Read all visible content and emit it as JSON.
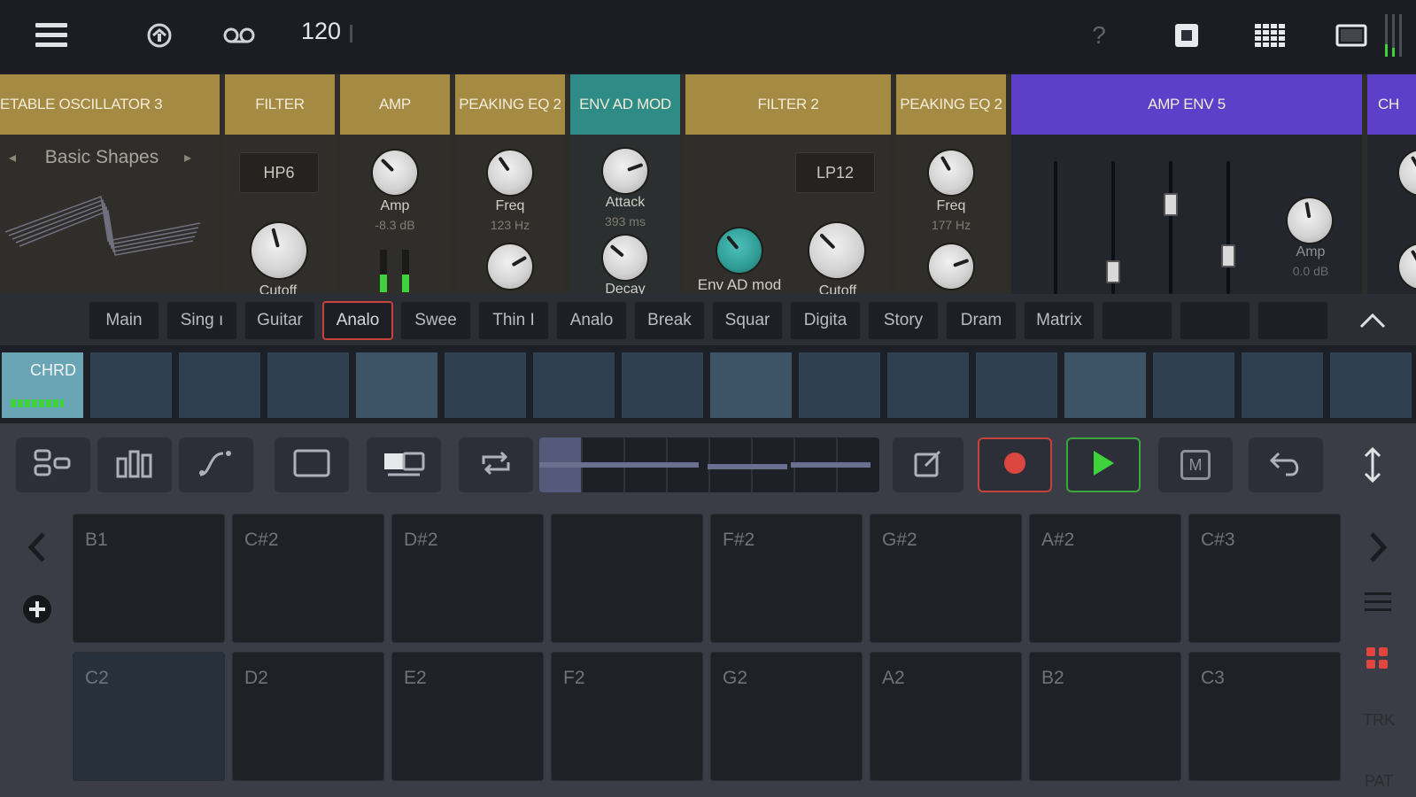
{
  "topbar": {
    "bpm": "120",
    "icons": [
      "menu-icon",
      "loop-icon",
      "tape-icon",
      "help-icon",
      "stop-icon",
      "grid-icon",
      "window-icon",
      "level-meter-icon"
    ],
    "help_label": "?"
  },
  "rack": {
    "devices": [
      {
        "title": "ETABLE OSCILLATOR 3",
        "color": "#a48a43",
        "preset": "Basic Shapes"
      },
      {
        "title": "FILTER",
        "color": "#a48a43",
        "mode": "HP6",
        "knob_label": "Cutoff"
      },
      {
        "title": "AMP",
        "color": "#a48a43",
        "knob_label": "Amp",
        "knob_value": "-8.3 dB"
      },
      {
        "title": "PEAKING EQ 2",
        "color": "#a48a43",
        "knob_label": "Freq",
        "knob_value": "123 Hz"
      },
      {
        "title": "ENV AD MOD",
        "color": "#2f8b86",
        "knob1_label": "Attack",
        "knob1_value": "393 ms",
        "knob2_label": "Decay"
      },
      {
        "title": "FILTER 2",
        "color": "#a48a43",
        "mode": "LP12",
        "mod_label": "Env AD mod",
        "knob_label": "Cutoff"
      },
      {
        "title": "PEAKING EQ 2",
        "color": "#a48a43",
        "knob_label": "Freq",
        "knob_value": "177 Hz"
      },
      {
        "title": "AMP ENV 5",
        "color": "#5e3fc9",
        "knob_label": "Amp",
        "knob_value": "0.0 dB"
      },
      {
        "title": "CH",
        "color": "#5e3fc9"
      }
    ]
  },
  "presets": {
    "tabs": [
      "Main",
      "Sing ı",
      "Guitar",
      "Analo",
      "Swee",
      "Thin I",
      "Analo",
      "Break",
      "Squar",
      "Digita",
      "Story",
      "Dram",
      "Matrix",
      "",
      "",
      ""
    ],
    "selected_index": 3
  },
  "clips": {
    "first_label": "CHRD",
    "count": 16,
    "light_indices": [
      4,
      8,
      12
    ]
  },
  "toolbar": {
    "icons": [
      "mixer-icon",
      "bars-icon",
      "curve-icon",
      "rectangle-icon",
      "screens-icon",
      "loop-icon",
      "edit-icon",
      "record-icon",
      "play-icon",
      "metronome-icon",
      "undo-icon",
      "resize-icon"
    ],
    "record_color": "#c8423c",
    "play_color": "#3ea63e",
    "metronome_label": "M"
  },
  "pads": {
    "row1": [
      "B1",
      "C#2",
      "D#2",
      "",
      "F#2",
      "G#2",
      "A#2",
      "C#3"
    ],
    "row2": [
      "C2",
      "D2",
      "E2",
      "F2",
      "G2",
      "A2",
      "B2",
      "C3"
    ],
    "side_labels": {
      "trk": "TRK",
      "pat": "PAT"
    }
  }
}
